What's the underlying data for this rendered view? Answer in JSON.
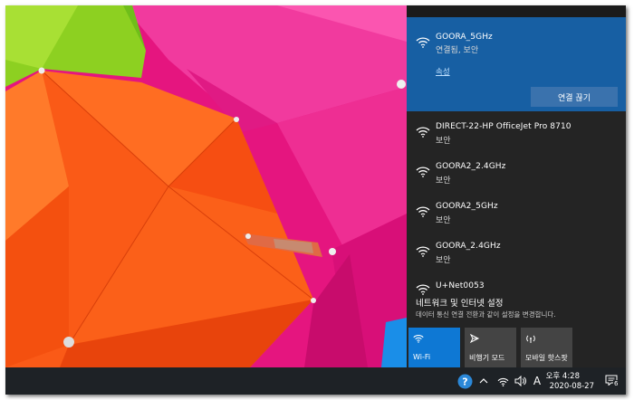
{
  "wifi_flyout": {
    "connected_network": {
      "name": "GOORA_5GHz",
      "status": "연결됨, 보안",
      "properties_link": "속성",
      "disconnect_label": "연결 끊기"
    },
    "networks": [
      {
        "name": "DIRECT-22-HP OfficeJet Pro 8710",
        "status": "보안"
      },
      {
        "name": "GOORA2_2.4GHz",
        "status": "보안"
      },
      {
        "name": "GOORA2_5GHz",
        "status": "보안"
      },
      {
        "name": "GOORA_2.4GHz",
        "status": "보안"
      },
      {
        "name": "U+Net0053",
        "status": ""
      }
    ],
    "settings_link": "네트워크 및 인터넷 설정",
    "settings_description": "데이터 통신 연결 전환과 같이 설정을 변경합니다.",
    "quick_actions": [
      {
        "label": "Wi-Fi",
        "icon": "wifi-icon",
        "active": true
      },
      {
        "label": "비행기 모드",
        "icon": "airplane-icon",
        "active": false
      },
      {
        "label": "모바일 핫스팟",
        "icon": "hotspot-icon",
        "active": false
      }
    ]
  },
  "taskbar": {
    "ime_indicator": "A",
    "time": "오후 4:28",
    "date": "2020-08-27",
    "notification_count": "6"
  },
  "colors": {
    "connected_bg": "#175fa3",
    "flyout_bg": "#242424",
    "wifi_tile_active": "#0e78d4",
    "taskbar_bg": "#1e2226"
  }
}
